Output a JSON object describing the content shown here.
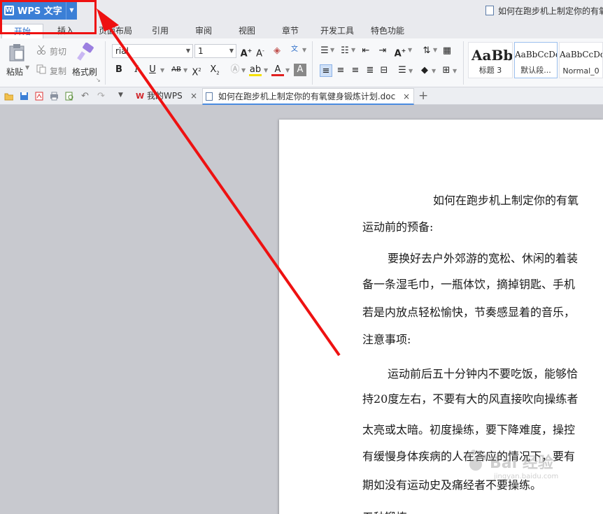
{
  "titlebar": {
    "app_menu_label": "WPS 文字",
    "document_title": "如何在跑步机上制定你的有氧"
  },
  "menu_tabs": [
    "开始",
    "插入",
    "页面布局",
    "引用",
    "审阅",
    "视图",
    "章节",
    "开发工具",
    "特色功能"
  ],
  "ribbon": {
    "paste": "粘贴",
    "cut": "剪切",
    "copy": "复制",
    "format_painter": "格式刷",
    "font_name": "rial",
    "font_size": "1",
    "styles": [
      {
        "preview": "AaBb(",
        "label": "标题 3"
      },
      {
        "preview": "AaBbCcDd",
        "label": "默认段..."
      },
      {
        "preview": "AaBbCcDd",
        "label": "Normal_0"
      }
    ]
  },
  "doc_tabs": {
    "home_tab": "我的WPS",
    "active_tab": "如何在跑步机上制定你的有氧健身锻炼计划.doc"
  },
  "document": {
    "lines": [
      "如何在跑步机上制定你的有氧",
      "运动前的预备:",
      "要换好去户外郊游的宽松、休闲的着装",
      "备一条湿毛巾，一瓶体饮，摘掉钥匙、手机",
      "若是内放点轻松愉快，节奏感显着的音乐，",
      "注意事项:",
      "运动前后五十分钟内不要吃饭，能够恰",
      "持20度左右，不要有大的风直接吹向操练者",
      "太亮或太暗。初度操练，要下降难度，操控",
      "有缓慢身体疾病的人在答应的情况下，要有",
      "期如没有运动史及痛经者不要操练。",
      "五种锻炼"
    ]
  },
  "watermark": {
    "text": "Bai 经验",
    "url_text": "jingyan.baidu.com"
  },
  "colors": {
    "accent": "#3b7fd6",
    "annotation": "#ee1111"
  }
}
